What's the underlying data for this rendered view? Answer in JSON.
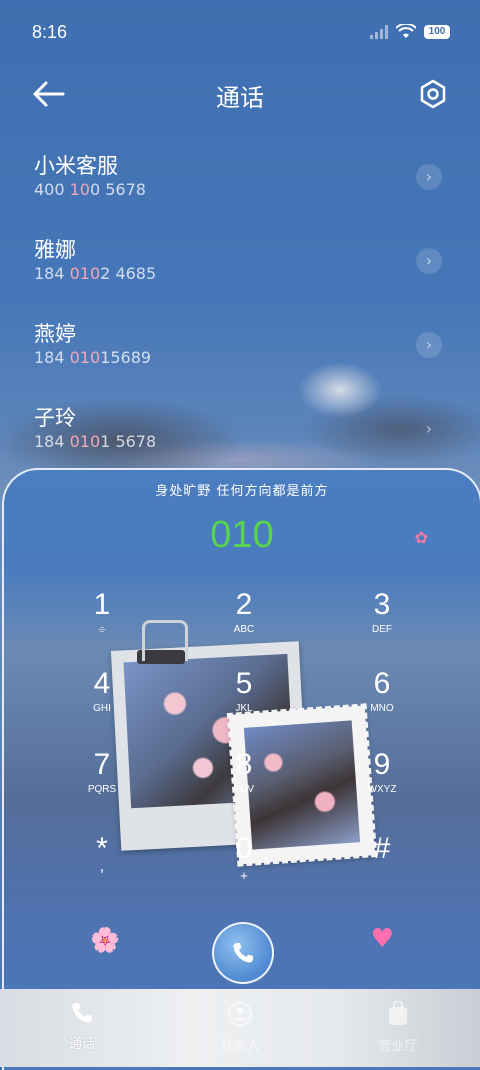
{
  "status_bar": {
    "time": "8:16",
    "battery": "100"
  },
  "header": {
    "title": "通话"
  },
  "contacts": [
    {
      "name": "小米客服",
      "num_pre": "400 ",
      "num_hl": "10",
      "num_post": "0 5678"
    },
    {
      "name": "雅娜",
      "num_pre": "184 ",
      "num_hl": "010",
      "num_post": "2 4685"
    },
    {
      "name": "燕婷",
      "num_pre": "184 ",
      "num_hl": "010",
      "num_post": "15689"
    },
    {
      "name": "子玲",
      "num_pre": "184 ",
      "num_hl": "010",
      "num_post": "1 5678"
    }
  ],
  "dialer": {
    "slogan": "身处旷野  任何方向都是前方",
    "number": "010",
    "keys": [
      {
        "digit": "1",
        "letters": "⌯"
      },
      {
        "digit": "2",
        "letters": "ABC"
      },
      {
        "digit": "3",
        "letters": "DEF"
      },
      {
        "digit": "4",
        "letters": "GHI"
      },
      {
        "digit": "5",
        "letters": "JKL"
      },
      {
        "digit": "6",
        "letters": "MNO"
      },
      {
        "digit": "7",
        "letters": "PQRS"
      },
      {
        "digit": "8",
        "letters": "TUV"
      },
      {
        "digit": "9",
        "letters": "WXYZ"
      },
      {
        "digit": "*",
        "letters": ","
      },
      {
        "digit": "0",
        "letters": "+"
      },
      {
        "digit": "#",
        "letters": ""
      }
    ]
  },
  "bottom_nav": [
    {
      "label": "通话",
      "icon": "phone-icon"
    },
    {
      "label": "联系人",
      "icon": "contacts-icon"
    },
    {
      "label": "营业厅",
      "icon": "store-icon"
    }
  ],
  "colors": {
    "accent_green": "#59d44f",
    "highlight_pink": "#f0a7b8"
  }
}
